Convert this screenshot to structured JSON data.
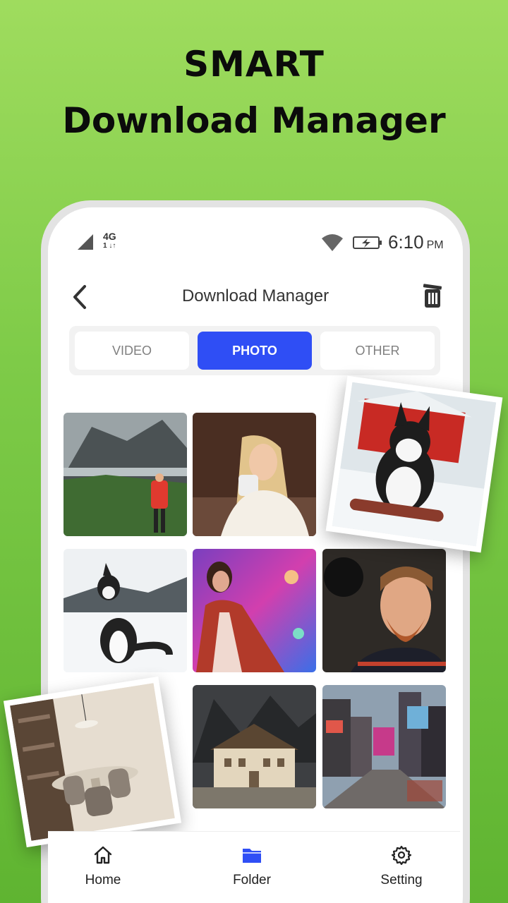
{
  "headline": {
    "line1": "SMART",
    "line2": "Download Manager"
  },
  "status_bar": {
    "network": "4G",
    "network_sub": "1 ↓↑",
    "time": "6:10",
    "ampm": "PM"
  },
  "app_bar": {
    "title": "Download Manager"
  },
  "tabs": [
    {
      "label": "VIDEO",
      "active": false
    },
    {
      "label": "PHOTO",
      "active": true
    },
    {
      "label": "OTHER",
      "active": false
    }
  ],
  "gallery": [
    {
      "icon": "mountain-hiker-photo"
    },
    {
      "icon": "woman-coffee-photo"
    },
    {
      "icon": "husky-snow-photo"
    },
    {
      "icon": "woman-neon-lights-photo"
    },
    {
      "icon": "bearded-man-photo"
    },
    {
      "icon": "house-mountains-photo"
    },
    {
      "icon": "city-street-photo"
    },
    {
      "icon": "husky-red-barn-photo"
    },
    {
      "icon": "dining-room-photo"
    }
  ],
  "bottom_nav": [
    {
      "label": "Home",
      "icon": "home-icon"
    },
    {
      "label": "Folder",
      "icon": "folder-icon"
    },
    {
      "label": "Setting",
      "icon": "gear-icon"
    }
  ],
  "colors": {
    "accent": "#2f4ef5",
    "background_green": "#7ecb48"
  }
}
